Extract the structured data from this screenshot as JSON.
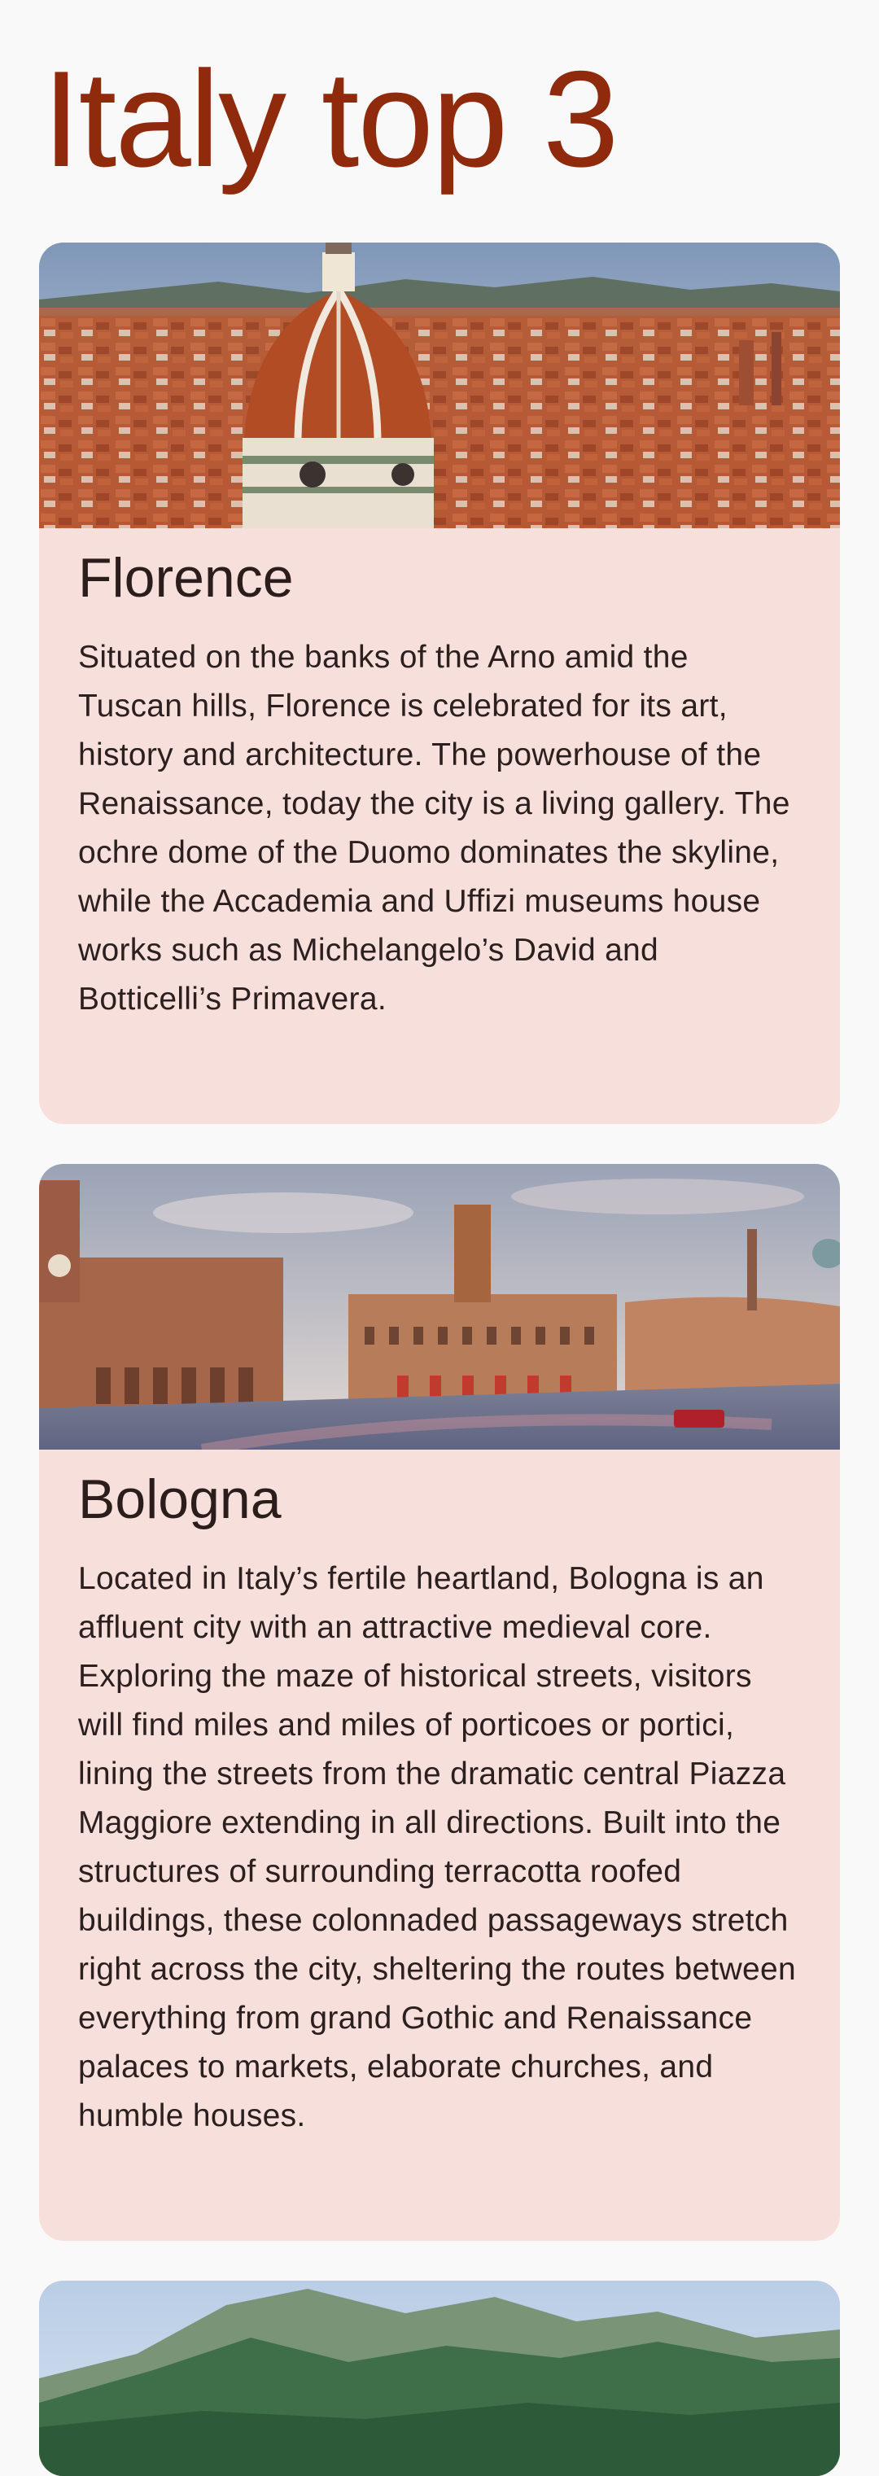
{
  "header": {
    "title": "Italy top 3"
  },
  "cards": [
    {
      "title": "Florence",
      "image_label": "florence-duomo-photo",
      "description": "Situated on the banks of the Arno amid the Tuscan hills, Florence is celebrated for its art, history and architecture. The powerhouse of the Renaissance, today the city is a living gallery. The ochre dome of the Duomo dominates the skyline, while the Accademia and Uffizi museums house works such as Michelangelo’s David and Botticelli’s Primavera."
    },
    {
      "title": "Bologna",
      "image_label": "bologna-piazza-maggiore-photo",
      "description": "Located in Italy’s fertile heartland, Bologna is an affluent city with an attractive medieval core. Exploring the maze of historical streets, visitors will find miles and miles of porticoes or portici, lining the streets from the dramatic central Piazza Maggiore extending in all directions. Built into the structures of surrounding terracotta roofed buildings, these colonnaded passageways stretch right across the city, sheltering the routes between everything from grand Gothic and Renaissance palaces to markets, elaborate churches, and humble houses."
    },
    {
      "title": "",
      "image_label": "mountain-landscape-photo",
      "description": ""
    }
  ],
  "colors": {
    "title": "#8f2a0c",
    "card_background": "#f7dfdb",
    "page_background": "#faf9fa",
    "body_text": "#2b201f"
  }
}
